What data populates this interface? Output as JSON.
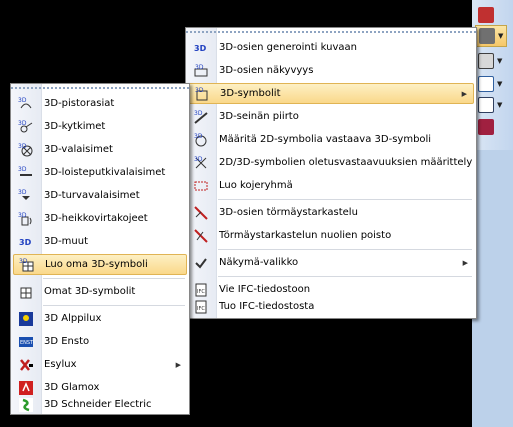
{
  "toolbar": {
    "buttons": [
      {
        "icon": "layers-red-icon",
        "color": "#c03030"
      },
      {
        "icon": "gear-3d-icon",
        "color": "#606060"
      },
      {
        "icon": "text-a-icon",
        "color": "#404040"
      },
      {
        "icon": "document-icon",
        "color": "#3060a0"
      },
      {
        "icon": "list-icon",
        "color": "#304060"
      },
      {
        "icon": "books-icon",
        "color": "#a02040"
      }
    ]
  },
  "right_menu": {
    "items": [
      {
        "label": "3D-osien generointi kuvaan",
        "icon": "3d-generate-icon"
      },
      {
        "label": "3D-osien näkyvyys",
        "icon": "3d-visibility-icon"
      },
      {
        "label": "3D-symbolit",
        "icon": "3d-symbols-icon"
      },
      {
        "label": "3D-seinän piirto",
        "icon": "wall-draw-icon"
      },
      {
        "label": "Määritä 2D-symbolia vastaava 3D-symboli",
        "icon": "symbol-map-icon"
      },
      {
        "label": "2D/3D-symbolien oletusvastaavuuksien määrittely",
        "icon": "symbol-default-icon"
      },
      {
        "label": "Luo kojeryhmä",
        "icon": "device-group-icon"
      },
      {
        "label": "3D-osien törmäystarkastelu",
        "icon": "collision-check-icon"
      },
      {
        "label": "Törmäystarkastelun nuolien poisto",
        "icon": "remove-arrows-icon"
      },
      {
        "label": "Näkymä-valikko",
        "icon": "view-menu-icon"
      },
      {
        "label": "Vie IFC-tiedostoon",
        "icon": "ifc-export-icon"
      },
      {
        "label": "Tuo IFC-tiedostosta",
        "icon": "ifc-import-icon"
      }
    ]
  },
  "left_menu": {
    "items": [
      {
        "label": "3D-pistorasiat",
        "icon": "socket-icon"
      },
      {
        "label": "3D-kytkimet",
        "icon": "switch-icon"
      },
      {
        "label": "3D-valaisimet",
        "icon": "lamp-icon"
      },
      {
        "label": "3D-loisteputkivalaisimet",
        "icon": "fluorescent-icon"
      },
      {
        "label": "3D-turvavalaisimet",
        "icon": "emergency-light-icon"
      },
      {
        "label": "3D-heikkovirtakojeet",
        "icon": "low-voltage-icon"
      },
      {
        "label": "3D-muut",
        "icon": "other-icon"
      },
      {
        "label": "Luo oma 3D-symboli",
        "icon": "create-symbol-icon"
      },
      {
        "label": "Omat 3D-symbolit",
        "icon": "own-symbols-icon"
      },
      {
        "label": "3D Alppilux",
        "icon": "alppilux-icon"
      },
      {
        "label": "3D Ensto",
        "icon": "ensto-icon"
      },
      {
        "label": "Esylux",
        "icon": "esylux-icon"
      },
      {
        "label": "3D Glamox",
        "icon": "glamox-icon"
      },
      {
        "label": "3D Schneider Electric",
        "icon": "schneider-icon"
      }
    ]
  }
}
